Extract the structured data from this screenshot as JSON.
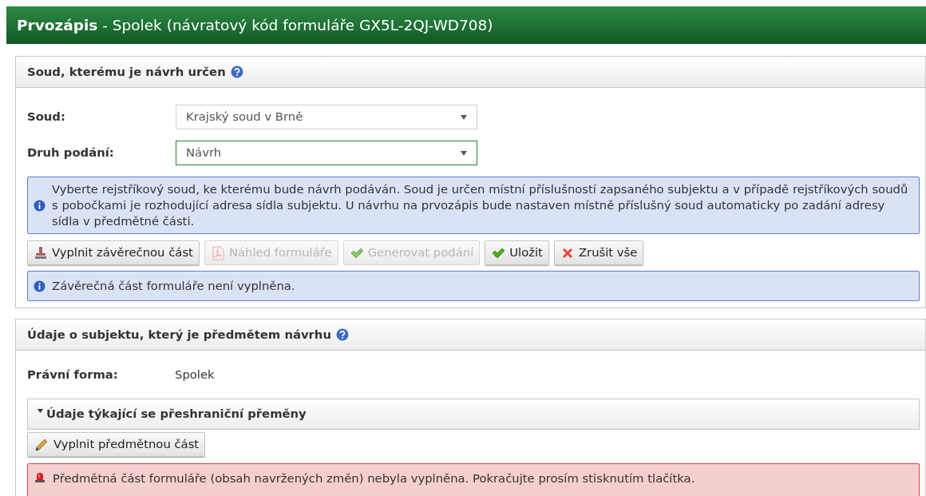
{
  "header": {
    "title": "**Prvozápis** - Spolek (návratový kód formuláře GX5L-2QJ-WD708)"
  },
  "court_section": {
    "title": "Soud, kterému je návrh určen",
    "fields": [
      {
        "label": "Soud:",
        "value": "Krajský soud v Brně",
        "focused": false
      },
      {
        "label": "Druh podání:",
        "value": "Návrh",
        "focused": true
      }
    ],
    "info": "Vyberte rejstříkový soud, ke kterému bude návrh podáván. Soud je určen místní příslušností zapsaného subjektu a v případě rejstříkových soudů s pobočkami je rozhodující adresa sídla subjektu. U návrhu na prvozápis bude nastaven místně příslušný soud automaticky po zadání adresy sídla v předmětné části.",
    "buttons": [
      {
        "label": "Vyplnit závěrečnou část",
        "kind": "stamp",
        "disabled": false
      },
      {
        "label": "Náhled formuláře",
        "kind": "pdf",
        "disabled": true
      },
      {
        "label": "Generovat podání",
        "kind": "check",
        "disabled": true
      },
      {
        "label": "Uložit",
        "kind": "check",
        "disabled": false
      },
      {
        "label": "Zrušit vše",
        "kind": "cross",
        "disabled": false
      }
    ],
    "notice": {
      "kind": "info",
      "text": "Závěrečná část formuláře není vyplněna."
    }
  },
  "subject_section": {
    "title": "Údaje o subjektu, který je předmětem návrhu",
    "fields": [
      {
        "label": "Právní forma:",
        "value": "Spolek"
      }
    ],
    "subsection": {
      "title": "Údaje týkající se přeshraniční přeměny",
      "expanded": true
    },
    "buttons": [
      {
        "label": "Vyplnit předmětnou část",
        "kind": "pencil",
        "disabled": false
      }
    ],
    "notice": {
      "kind": "error",
      "text": "Předmětná část formuláře (obsah navržených změn) nebyla vyplněna. Pokračujte prosím stisknutím tlačítka."
    }
  }
}
